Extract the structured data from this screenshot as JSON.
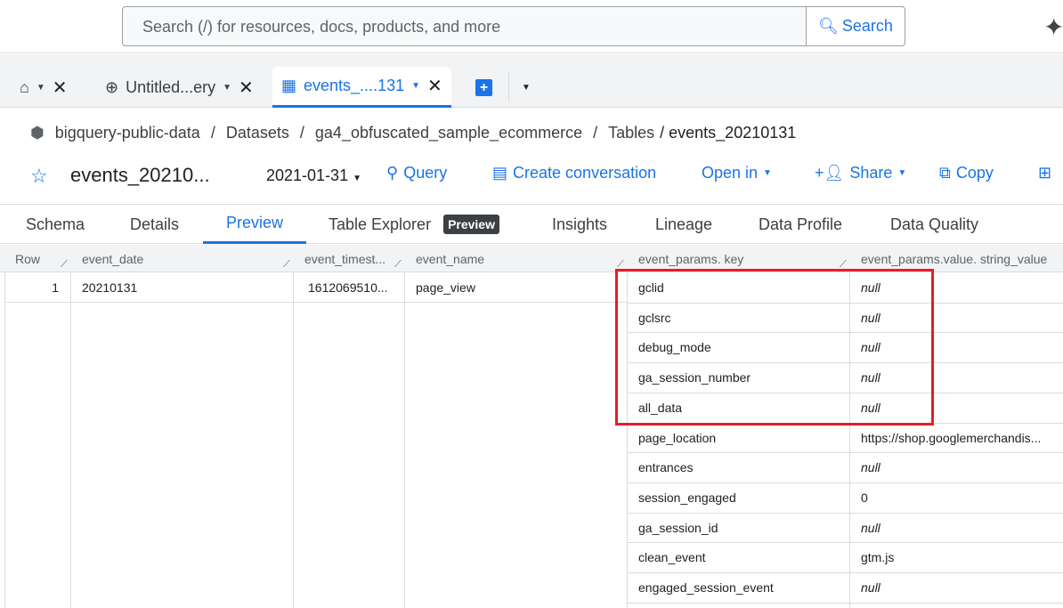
{
  "search": {
    "placeholder": "Search (/) for resources, docs, products, and more",
    "button": "Search"
  },
  "tabs": [
    {
      "label": ""
    },
    {
      "label": "Untitled...ery"
    },
    {
      "label": "events_....131"
    }
  ],
  "breadcrumb": [
    "bigquery-public-data",
    "/",
    "Datasets",
    "/",
    "ga4_obfuscated_sample_ecommerce",
    "/",
    "Tables",
    "/ events_20210131"
  ],
  "title": "events_20210...",
  "date_select": "2021-01-31",
  "actions": {
    "query": "Query",
    "create_conversation": "Create conversation",
    "open_in": "Open in",
    "share": "Share",
    "copy": "Copy"
  },
  "subtabs": [
    "Schema",
    "Details",
    "Preview",
    "Table Explorer",
    "Insights",
    "Lineage",
    "Data Profile",
    "Data Quality"
  ],
  "preview_badge": "Preview",
  "columns": [
    "Row",
    "event_date",
    "event_timest...",
    "event_name",
    "event_params. key",
    "event_params.value. string_value"
  ],
  "row": {
    "num": "1",
    "event_date": "20210131",
    "event_timestamp": "1612069510...",
    "event_name": "page_view"
  },
  "params": [
    {
      "key": "gclid",
      "value": "null"
    },
    {
      "key": "gclsrc",
      "value": "null"
    },
    {
      "key": "debug_mode",
      "value": "null"
    },
    {
      "key": "ga_session_number",
      "value": "null"
    },
    {
      "key": "all_data",
      "value": "null"
    },
    {
      "key": "page_location",
      "value": "https://shop.googlemerchandis..."
    },
    {
      "key": "entrances",
      "value": "null"
    },
    {
      "key": "session_engaged",
      "value": "0"
    },
    {
      "key": "ga_session_id",
      "value": "null"
    },
    {
      "key": "clean_event",
      "value": "gtm.js"
    },
    {
      "key": "engaged_session_event",
      "value": "null"
    }
  ],
  "colors": {
    "accent": "#1a73e8",
    "highlight": "#e41e26"
  }
}
